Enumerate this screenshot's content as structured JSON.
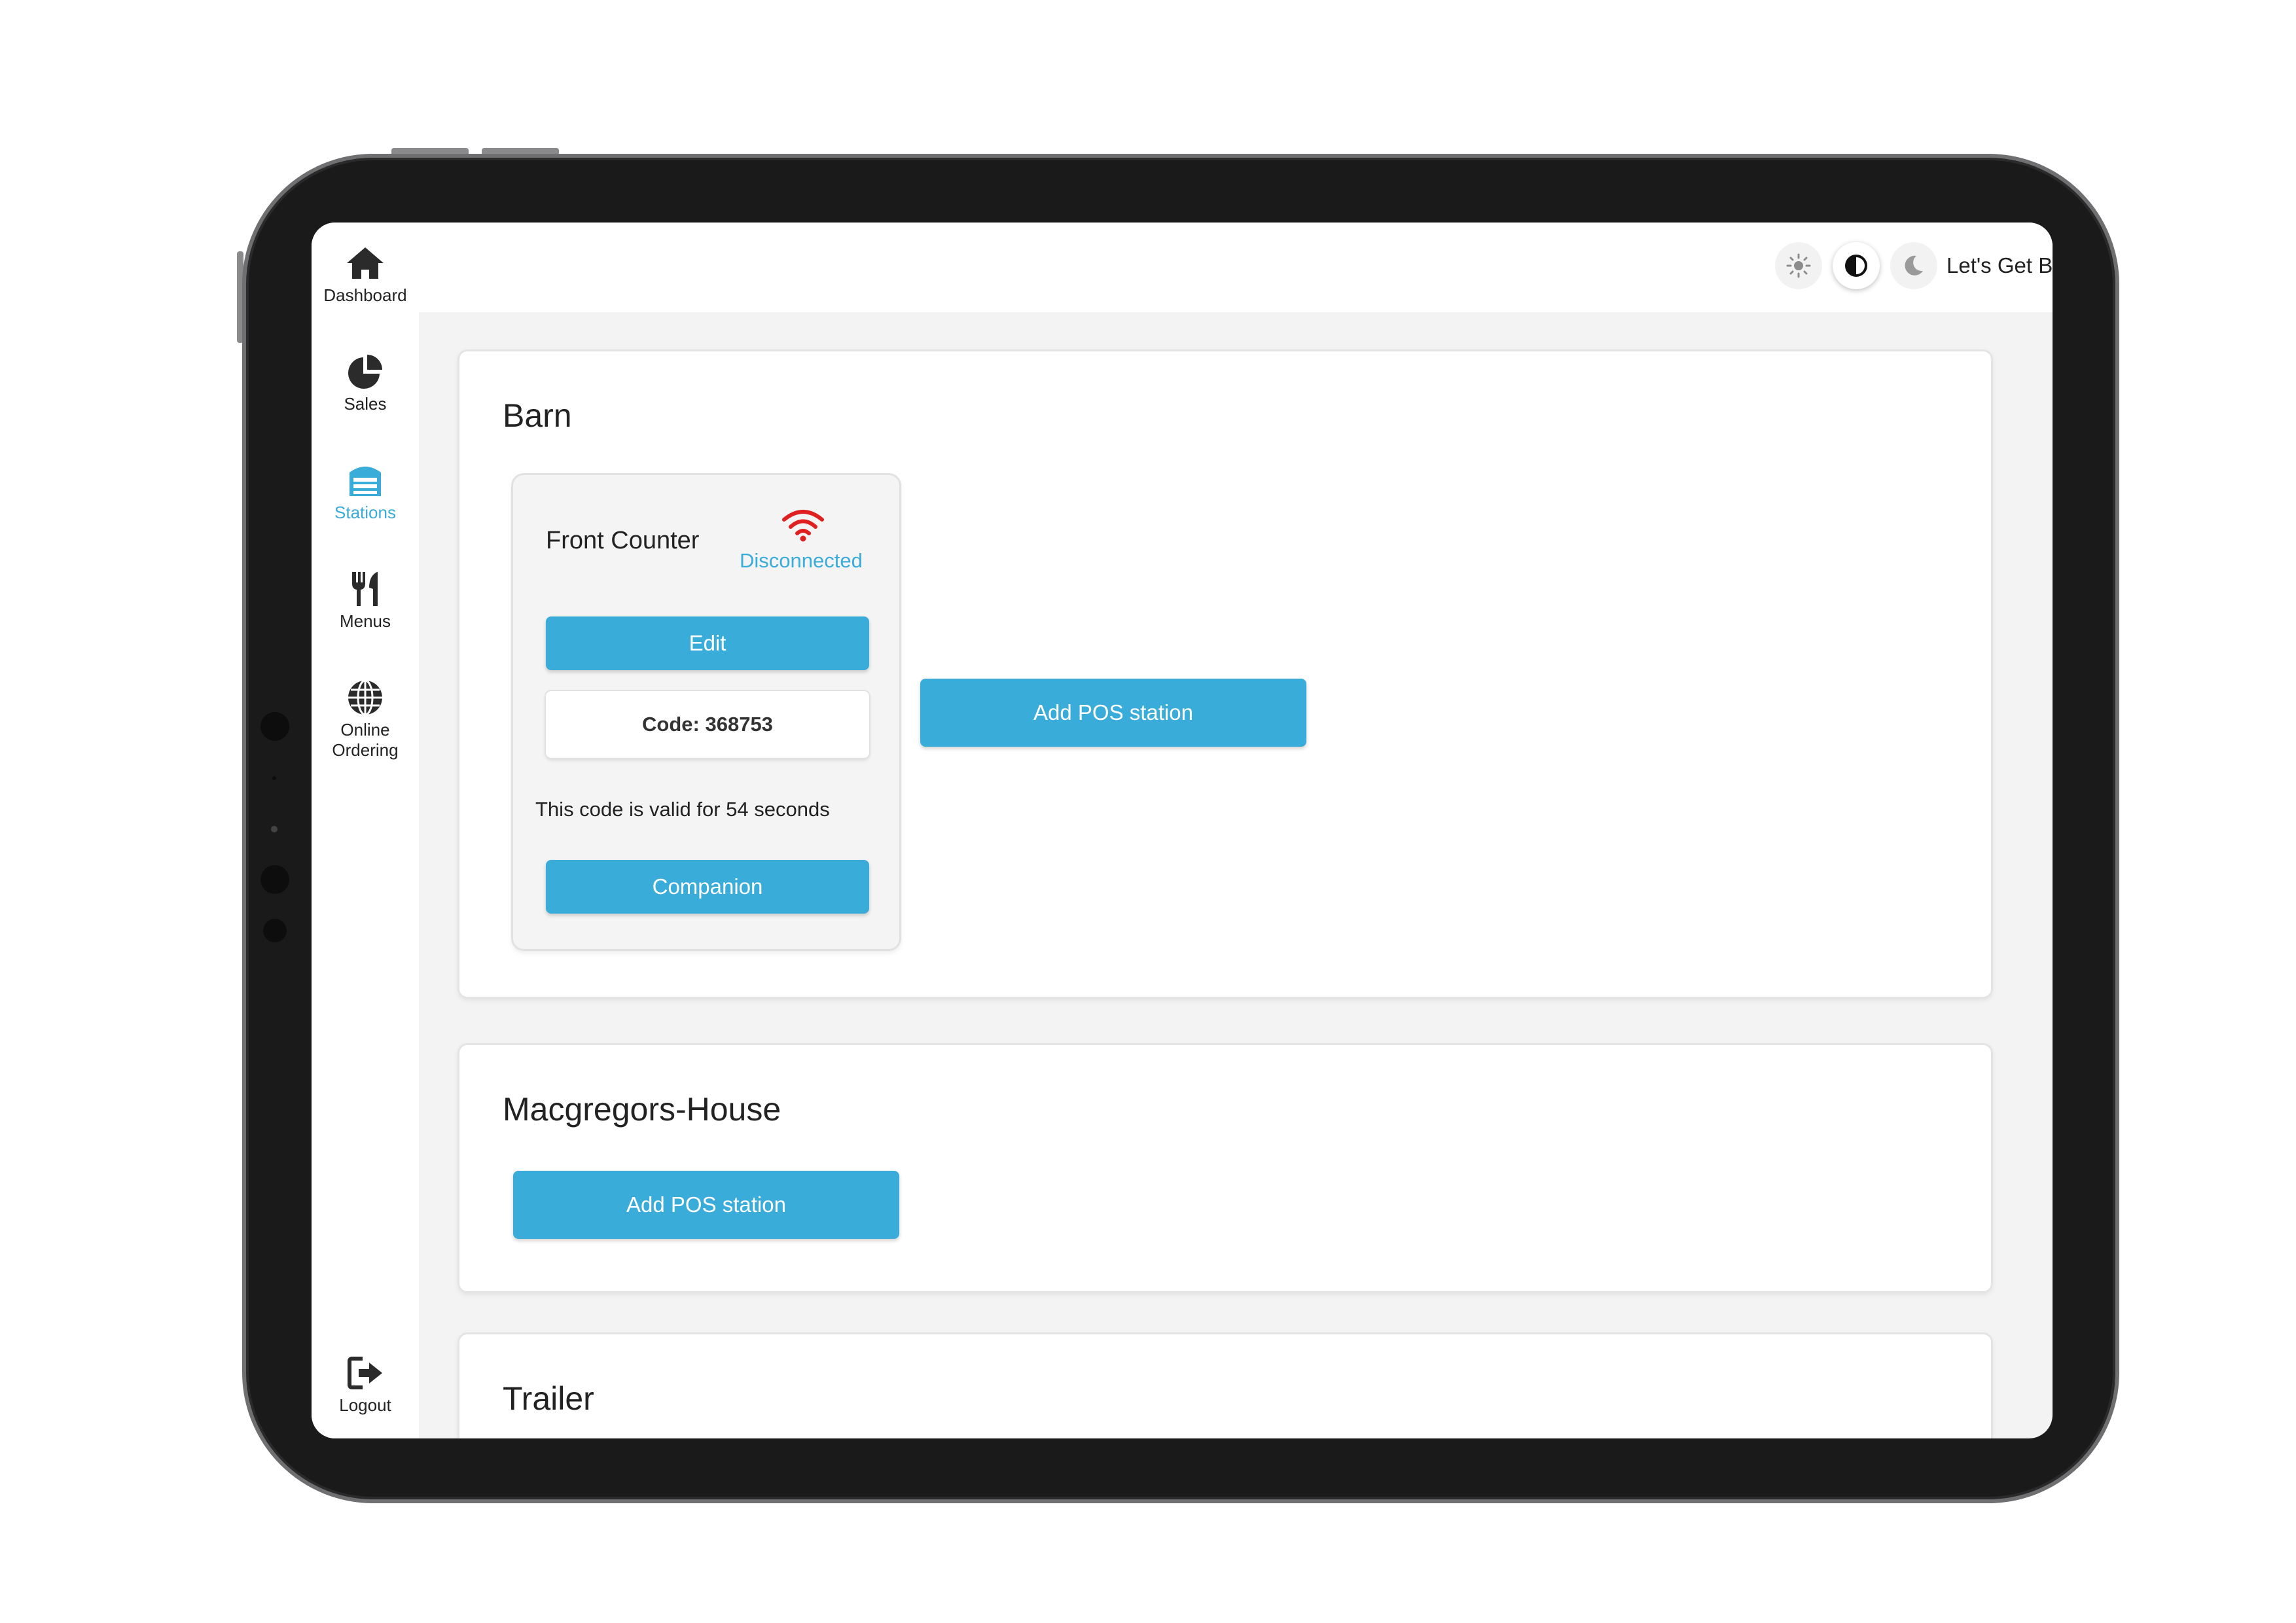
{
  "colors": {
    "accent": "#3aacd9",
    "disconnected_icon": "#e02020",
    "text": "#222222",
    "content_bg": "#f3f3f3"
  },
  "sidebar": {
    "items": [
      {
        "label": "Dashboard",
        "icon": "home-icon",
        "active": false
      },
      {
        "label": "Sales",
        "icon": "pie-chart-icon",
        "active": false
      },
      {
        "label": "Stations",
        "icon": "cash-register-icon",
        "active": true
      },
      {
        "label": "Menus",
        "icon": "utensils-icon",
        "active": false
      },
      {
        "label": "Online Ordering",
        "icon": "globe-icon",
        "active": false
      }
    ],
    "logout": {
      "label": "Logout",
      "icon": "sign-out-icon"
    }
  },
  "header": {
    "theme_options": [
      {
        "name": "light",
        "icon": "sun-icon",
        "selected": false
      },
      {
        "name": "auto",
        "icon": "contrast-icon",
        "selected": true
      },
      {
        "name": "dark",
        "icon": "moon-icon",
        "selected": false
      }
    ],
    "business_name": "Let's Get Baked",
    "settings_icon": "wrench-icon"
  },
  "locations": [
    {
      "name": "Barn",
      "stations": [
        {
          "name": "Front Counter",
          "status": "Disconnected",
          "status_icon": "wifi-icon",
          "edit_label": "Edit",
          "code_text": "Code: 368753",
          "validity_text": "This code is valid for 54 seconds",
          "companion_label": "Companion"
        }
      ],
      "add_label": "Add POS station"
    },
    {
      "name": "Macgregors-House",
      "stations": [],
      "add_label": "Add POS station"
    },
    {
      "name": "Trailer",
      "stations": []
    }
  ]
}
